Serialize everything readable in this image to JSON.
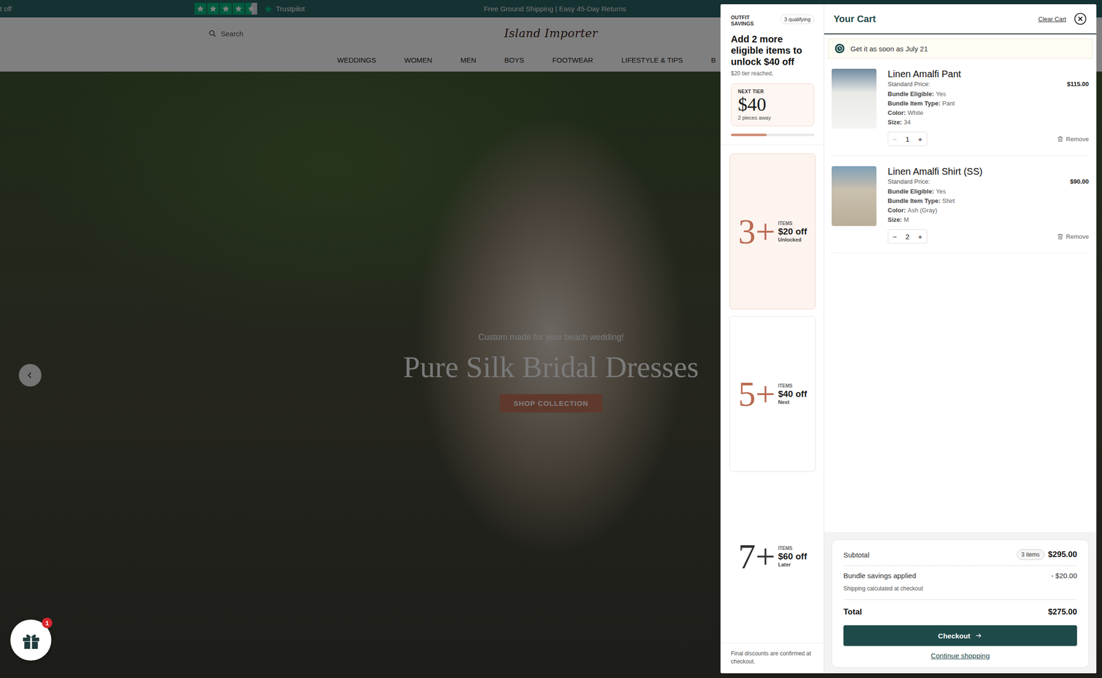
{
  "announcement_bar": {
    "cut_text": "t off",
    "trustpilot": {
      "stars": 4.5,
      "label": "Trustpilot"
    },
    "message": "Free Ground Shipping | Easy 45-Day Returns"
  },
  "header": {
    "search_placeholder": "Search",
    "logo": "Island Importer",
    "nav": [
      "WEDDINGS",
      "WOMEN",
      "MEN",
      "BOYS",
      "FOOTWEAR",
      "LIFESTYLE & TIPS",
      "B"
    ]
  },
  "hero": {
    "subtitle": "Custom made for your beach wedding!",
    "title": "Pure Silk Bridal Dresses",
    "button": "SHOP COLLECTION"
  },
  "gift_widget": {
    "badge": "1"
  },
  "savings": {
    "label": "OUTFIT SAVINGS",
    "badge": "3 qualifying",
    "headline": "Add 2 more eligible items to unlock $40 off",
    "reached": "$20 tier reached.",
    "next_tier": {
      "label": "NEXT TIER",
      "amount": "$40",
      "away": "2 pieces away",
      "level": 0.43
    },
    "tiers": [
      {
        "count": "3+",
        "items_label": "ITEMS",
        "discount": "$20 off",
        "status": "Unlocked",
        "kind": "unlocked"
      },
      {
        "count": "5+",
        "items_label": "ITEMS",
        "discount": "$40 off",
        "status": "Next",
        "kind": "next"
      },
      {
        "count": "7+",
        "items_label": "ITEMS",
        "discount": "$60 off",
        "status": "Later",
        "kind": "later"
      }
    ],
    "footnote": "Final discounts are confirmed at checkout."
  },
  "cart": {
    "title": "Your Cart",
    "clear": "Clear Cart",
    "delivery": "Get it as soon as July 21",
    "items": [
      {
        "name": "Linen Amalfi Pant",
        "price_label": "Standard Price:",
        "price": "$115.00",
        "details": [
          {
            "label": "Bundle Eligible:",
            "value": "Yes"
          },
          {
            "label": "Bundle Item Type:",
            "value": "Pant"
          },
          {
            "label": "Color:",
            "value": "White"
          },
          {
            "label": "Size:",
            "value": "34"
          }
        ],
        "minus": "−",
        "quantity": "1",
        "plus": "+",
        "minus_disabled": true,
        "remove": "Remove"
      },
      {
        "name": "Linen Amalfi Shirt (SS)",
        "price_label": "Standard Price:",
        "price": "$90.00",
        "details": [
          {
            "label": "Bundle Eligible:",
            "value": "Yes"
          },
          {
            "label": "Bundle Item Type:",
            "value": "Shirt"
          },
          {
            "label": "Color:",
            "value": "Ash (Gray)"
          },
          {
            "label": "Size:",
            "value": "M"
          }
        ],
        "minus": "−",
        "quantity": "2",
        "plus": "+",
        "minus_disabled": false,
        "remove": "Remove"
      }
    ],
    "summary": {
      "subtotal_label": "Subtotal",
      "count_badge": "3 items",
      "subtotal": "$295.00",
      "savings_label": "Bundle savings applied",
      "savings": "- $20.00",
      "shipping_note": "Shipping calculated at checkout",
      "total_label": "Total",
      "total": "$275.00",
      "checkout": "Checkout",
      "continue": "Continue shopping"
    }
  }
}
